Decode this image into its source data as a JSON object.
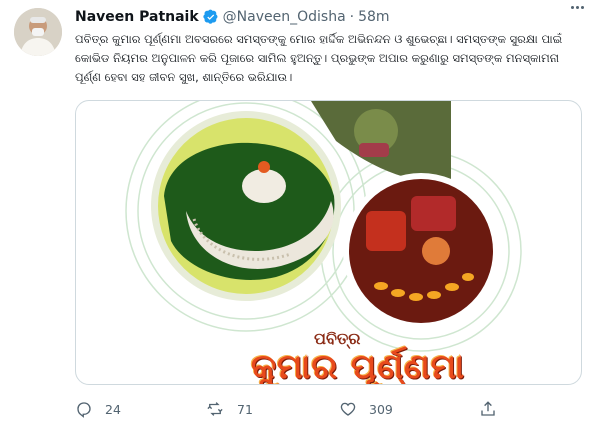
{
  "tweet": {
    "author_name": "Naveen Patnaik",
    "handle": "@Naveen_Odisha",
    "separator": "·",
    "time": "58m",
    "text": "ପବିତ୍ର କୁମାର ପୂର୍ଣ୍ଣମା ଅବସରରେ ସମସ୍ତଙ୍କୁ ମୋର ହାର୍ଦ୍ଦିକ ଅଭିନନ୍ଦନ ଓ ଶୁଭେଚ୍ଛା। ସମସ୍ତଙ୍କ ସୁରକ୍ଷା ପାଇଁ କୋଭିଡ ନିୟମର ଅନୁପାଳନ କରି ପୂଜାରେ ସାମିଲ ହୁଅନ୍ତୁ। ପ୍ରଭୁଙ୍କ ଅପାର କରୁଣାରୁ ସମସ୍ତଙ୍କ ମନସ୍କାମନା ପୂର୍ଣ୍ଣ ହେବା ସହ ଜୀବନ ସୁଖ, ଶାନ୍ତିରେ ଭରିଯାଉ।",
    "media": {
      "caption_small": "ପବିତ୍ର",
      "caption_big": "କୁମାର ପୂର୍ଣ୍ଣମା"
    },
    "actions": {
      "replies": "24",
      "retweets": "71",
      "likes": "309"
    }
  },
  "colors": {
    "accent": "#1d9bf0",
    "muted": "#536471",
    "border": "#cfd9de",
    "caption": "#e84a1c"
  },
  "icons": [
    "more-icon",
    "verified-badge-icon",
    "reply-icon",
    "retweet-icon",
    "like-icon",
    "share-icon"
  ]
}
